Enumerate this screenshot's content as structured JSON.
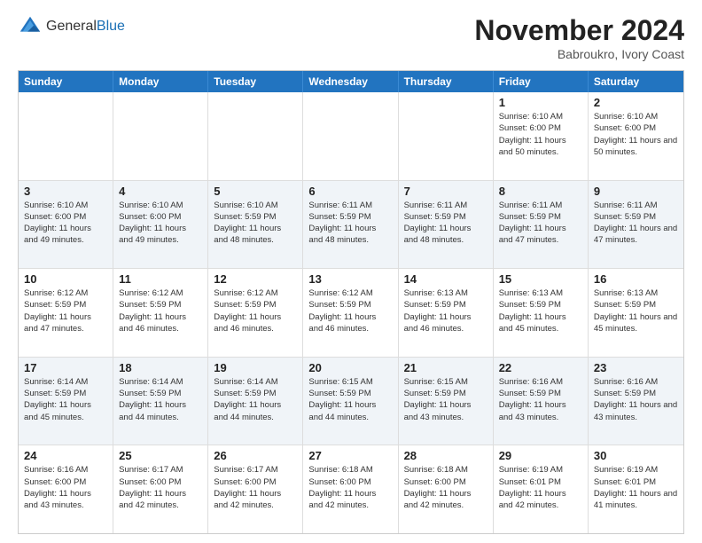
{
  "logo": {
    "general": "General",
    "blue": "Blue"
  },
  "title": "November 2024",
  "subtitle": "Babroukro, Ivory Coast",
  "days": [
    "Sunday",
    "Monday",
    "Tuesday",
    "Wednesday",
    "Thursday",
    "Friday",
    "Saturday"
  ],
  "rows": [
    [
      {
        "day": "",
        "info": ""
      },
      {
        "day": "",
        "info": ""
      },
      {
        "day": "",
        "info": ""
      },
      {
        "day": "",
        "info": ""
      },
      {
        "day": "",
        "info": ""
      },
      {
        "day": "1",
        "info": "Sunrise: 6:10 AM\nSunset: 6:00 PM\nDaylight: 11 hours and 50 minutes."
      },
      {
        "day": "2",
        "info": "Sunrise: 6:10 AM\nSunset: 6:00 PM\nDaylight: 11 hours and 50 minutes."
      }
    ],
    [
      {
        "day": "3",
        "info": "Sunrise: 6:10 AM\nSunset: 6:00 PM\nDaylight: 11 hours and 49 minutes."
      },
      {
        "day": "4",
        "info": "Sunrise: 6:10 AM\nSunset: 6:00 PM\nDaylight: 11 hours and 49 minutes."
      },
      {
        "day": "5",
        "info": "Sunrise: 6:10 AM\nSunset: 5:59 PM\nDaylight: 11 hours and 48 minutes."
      },
      {
        "day": "6",
        "info": "Sunrise: 6:11 AM\nSunset: 5:59 PM\nDaylight: 11 hours and 48 minutes."
      },
      {
        "day": "7",
        "info": "Sunrise: 6:11 AM\nSunset: 5:59 PM\nDaylight: 11 hours and 48 minutes."
      },
      {
        "day": "8",
        "info": "Sunrise: 6:11 AM\nSunset: 5:59 PM\nDaylight: 11 hours and 47 minutes."
      },
      {
        "day": "9",
        "info": "Sunrise: 6:11 AM\nSunset: 5:59 PM\nDaylight: 11 hours and 47 minutes."
      }
    ],
    [
      {
        "day": "10",
        "info": "Sunrise: 6:12 AM\nSunset: 5:59 PM\nDaylight: 11 hours and 47 minutes."
      },
      {
        "day": "11",
        "info": "Sunrise: 6:12 AM\nSunset: 5:59 PM\nDaylight: 11 hours and 46 minutes."
      },
      {
        "day": "12",
        "info": "Sunrise: 6:12 AM\nSunset: 5:59 PM\nDaylight: 11 hours and 46 minutes."
      },
      {
        "day": "13",
        "info": "Sunrise: 6:12 AM\nSunset: 5:59 PM\nDaylight: 11 hours and 46 minutes."
      },
      {
        "day": "14",
        "info": "Sunrise: 6:13 AM\nSunset: 5:59 PM\nDaylight: 11 hours and 46 minutes."
      },
      {
        "day": "15",
        "info": "Sunrise: 6:13 AM\nSunset: 5:59 PM\nDaylight: 11 hours and 45 minutes."
      },
      {
        "day": "16",
        "info": "Sunrise: 6:13 AM\nSunset: 5:59 PM\nDaylight: 11 hours and 45 minutes."
      }
    ],
    [
      {
        "day": "17",
        "info": "Sunrise: 6:14 AM\nSunset: 5:59 PM\nDaylight: 11 hours and 45 minutes."
      },
      {
        "day": "18",
        "info": "Sunrise: 6:14 AM\nSunset: 5:59 PM\nDaylight: 11 hours and 44 minutes."
      },
      {
        "day": "19",
        "info": "Sunrise: 6:14 AM\nSunset: 5:59 PM\nDaylight: 11 hours and 44 minutes."
      },
      {
        "day": "20",
        "info": "Sunrise: 6:15 AM\nSunset: 5:59 PM\nDaylight: 11 hours and 44 minutes."
      },
      {
        "day": "21",
        "info": "Sunrise: 6:15 AM\nSunset: 5:59 PM\nDaylight: 11 hours and 43 minutes."
      },
      {
        "day": "22",
        "info": "Sunrise: 6:16 AM\nSunset: 5:59 PM\nDaylight: 11 hours and 43 minutes."
      },
      {
        "day": "23",
        "info": "Sunrise: 6:16 AM\nSunset: 5:59 PM\nDaylight: 11 hours and 43 minutes."
      }
    ],
    [
      {
        "day": "24",
        "info": "Sunrise: 6:16 AM\nSunset: 6:00 PM\nDaylight: 11 hours and 43 minutes."
      },
      {
        "day": "25",
        "info": "Sunrise: 6:17 AM\nSunset: 6:00 PM\nDaylight: 11 hours and 42 minutes."
      },
      {
        "day": "26",
        "info": "Sunrise: 6:17 AM\nSunset: 6:00 PM\nDaylight: 11 hours and 42 minutes."
      },
      {
        "day": "27",
        "info": "Sunrise: 6:18 AM\nSunset: 6:00 PM\nDaylight: 11 hours and 42 minutes."
      },
      {
        "day": "28",
        "info": "Sunrise: 6:18 AM\nSunset: 6:00 PM\nDaylight: 11 hours and 42 minutes."
      },
      {
        "day": "29",
        "info": "Sunrise: 6:19 AM\nSunset: 6:01 PM\nDaylight: 11 hours and 42 minutes."
      },
      {
        "day": "30",
        "info": "Sunrise: 6:19 AM\nSunset: 6:01 PM\nDaylight: 11 hours and 41 minutes."
      }
    ]
  ]
}
